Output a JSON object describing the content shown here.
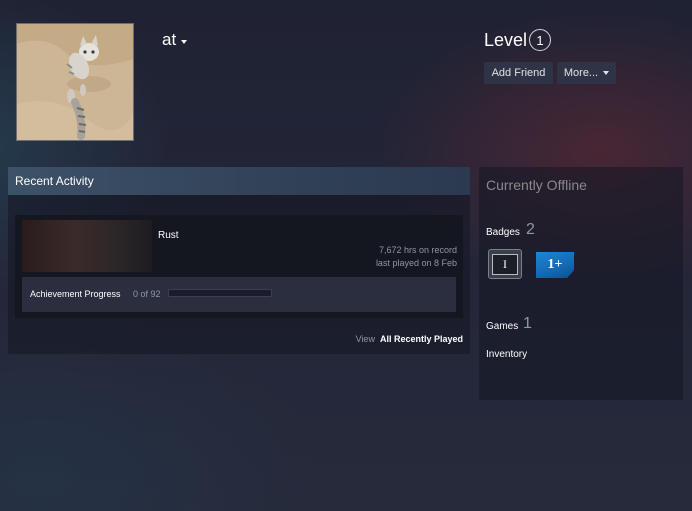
{
  "profile": {
    "username": "at",
    "level_label": "Level",
    "level_value": "1",
    "buttons": {
      "add_friend": "Add Friend",
      "more": "More..."
    },
    "avatar_icon": "cat-avatar-image"
  },
  "recent_activity": {
    "title": "Recent Activity",
    "game": {
      "name": "Rust",
      "hours": "7,672 hrs on record",
      "last_played": "last played on 8 Feb",
      "achievement_label": "Achievement Progress",
      "achievement_count": "0 of 92",
      "achievement_progress": 0
    },
    "view_prefix": "View",
    "view_link": "All Recently Played"
  },
  "sidebar": {
    "status": "Currently Offline",
    "badges_label": "Badges",
    "badges_count": "2",
    "badges": [
      {
        "icon": "years-of-service-badge",
        "text": "I"
      },
      {
        "icon": "level-one-plus-badge",
        "text": "1+"
      }
    ],
    "games_label": "Games",
    "games_count": "1",
    "inventory_label": "Inventory"
  },
  "colors": {
    "background": "#232638",
    "header_accent": "#3d5168",
    "badge_blue": "#1d86d4",
    "muted_text": "#8f98a0"
  }
}
